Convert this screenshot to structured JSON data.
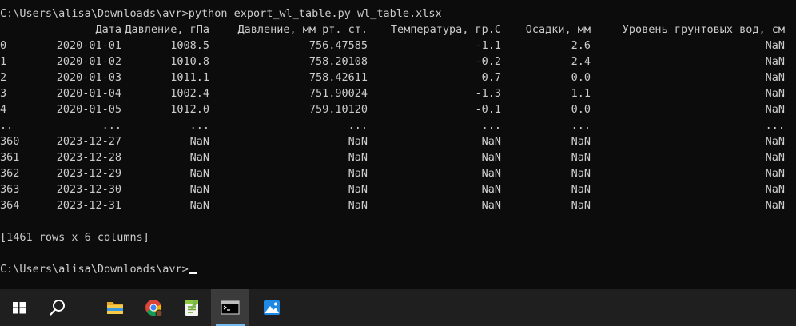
{
  "terminal": {
    "command_line": "C:\\Users\\alisa\\Downloads\\avr>python export_wl_table.py wl_table.xlsx",
    "headers": [
      "Дата",
      "Давление, гПа",
      "Давление, мм рт. ст.",
      "Температура, гр.С",
      "Осадки, мм",
      "Уровень грунтовых вод, см"
    ],
    "rows": [
      [
        "0",
        "2020-01-01",
        "1008.5",
        "756.47585",
        "-1.1",
        "2.6",
        "NaN"
      ],
      [
        "1",
        "2020-01-02",
        "1010.8",
        "758.20108",
        "-0.2",
        "2.4",
        "NaN"
      ],
      [
        "2",
        "2020-01-03",
        "1011.1",
        "758.42611",
        "0.7",
        "0.0",
        "NaN"
      ],
      [
        "3",
        "2020-01-04",
        "1002.4",
        "751.90024",
        "-1.3",
        "1.1",
        "NaN"
      ],
      [
        "4",
        "2020-01-05",
        "1012.0",
        "759.10120",
        "-0.1",
        "0.0",
        "NaN"
      ],
      [
        "..",
        "...",
        "...",
        "...",
        "...",
        "...",
        "..."
      ],
      [
        "360",
        "2023-12-27",
        "NaN",
        "NaN",
        "NaN",
        "NaN",
        "NaN"
      ],
      [
        "361",
        "2023-12-28",
        "NaN",
        "NaN",
        "NaN",
        "NaN",
        "NaN"
      ],
      [
        "362",
        "2023-12-29",
        "NaN",
        "NaN",
        "NaN",
        "NaN",
        "NaN"
      ],
      [
        "363",
        "2023-12-30",
        "NaN",
        "NaN",
        "NaN",
        "NaN",
        "NaN"
      ],
      [
        "364",
        "2023-12-31",
        "NaN",
        "NaN",
        "NaN",
        "NaN",
        "NaN"
      ]
    ],
    "summary": "[1461 rows x 6 columns]",
    "prompt": "C:\\Users\\alisa\\Downloads\\avr>"
  },
  "taskbar": {
    "items": [
      {
        "icon": "windows-start-icon",
        "active": false
      },
      {
        "icon": "search-icon",
        "active": false
      },
      {
        "icon": "file-explorer-icon",
        "active": false
      },
      {
        "icon": "chrome-icon",
        "active": false
      },
      {
        "icon": "notepad-plus-icon",
        "active": false
      },
      {
        "icon": "command-prompt-icon",
        "active": true
      },
      {
        "icon": "photos-icon",
        "active": false
      }
    ]
  },
  "colors": {
    "terminal_bg": "#0c0c0c",
    "terminal_fg": "#cccccc",
    "taskbar_bg": "#1f1f1f",
    "active_indicator": "#76b9ed"
  }
}
